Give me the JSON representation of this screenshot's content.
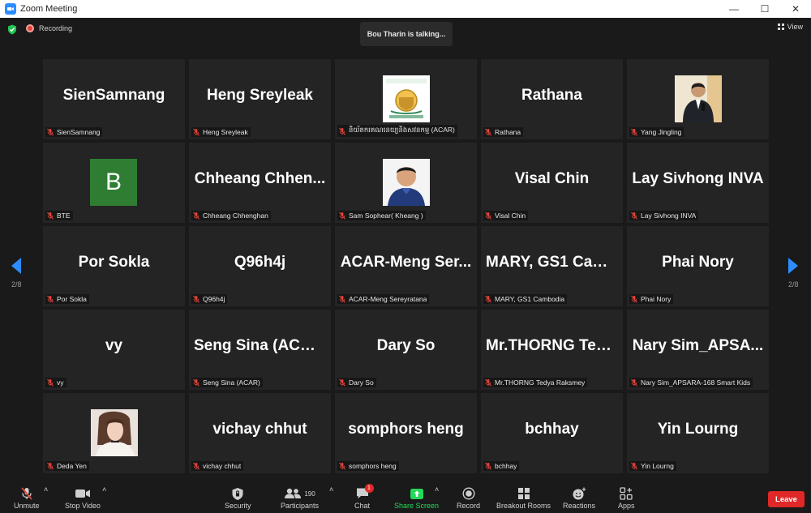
{
  "window": {
    "title": "Zoom Meeting",
    "controls": [
      "—",
      "☐",
      "✕"
    ]
  },
  "header": {
    "recording_label": "Recording",
    "talking_banner": "Bou Tharin is talking...",
    "view_label": "View"
  },
  "pagination": {
    "left_page": "2/8",
    "right_page": "2/8"
  },
  "participants": [
    {
      "big": "SienSamnang",
      "label": "SienSamnang",
      "kind": "name"
    },
    {
      "big": "Heng Sreyleak",
      "label": "Heng Sreyleak",
      "kind": "name"
    },
    {
      "big": "",
      "label": "និយ័តករគណនេយ្យនិងសវនកម្ម (ACAR)",
      "kind": "logo"
    },
    {
      "big": "Rathana",
      "label": "Rathana",
      "kind": "name"
    },
    {
      "big": "",
      "label": "Yang Jingling",
      "kind": "photo-man-suit"
    },
    {
      "big": "B",
      "label": "BTE",
      "kind": "avatar-letter",
      "avatar_color": "#2e7d32"
    },
    {
      "big": "Chheang  Chhen...",
      "label": "Chheang Chhenghan",
      "kind": "name"
    },
    {
      "big": "",
      "label": "Sam Sophear( Kheang )",
      "kind": "photo-man-blue"
    },
    {
      "big": "Visal Chin",
      "label": "Visal Chin",
      "kind": "name"
    },
    {
      "big": "Lay Sivhong INVA",
      "label": "Lay Sivhong INVA",
      "kind": "name"
    },
    {
      "big": "Por Sokla",
      "label": "Por Sokla",
      "kind": "name"
    },
    {
      "big": "Q96h4j",
      "label": "Q96h4j",
      "kind": "name"
    },
    {
      "big": "ACAR-Meng  Ser...",
      "label": "ACAR-Meng Sereyratana",
      "kind": "name"
    },
    {
      "big": "MARY,  GS1  Cam...",
      "label": "MARY, GS1 Cambodia",
      "kind": "name"
    },
    {
      "big": "Phai Nory",
      "label": "Phai Nory",
      "kind": "name"
    },
    {
      "big": "vy",
      "label": "vy",
      "kind": "name"
    },
    {
      "big": "Seng Sina (ACAR)",
      "label": "Seng Sina (ACAR)",
      "kind": "name"
    },
    {
      "big": "Dary So",
      "label": "Dary So",
      "kind": "name"
    },
    {
      "big": "Mr.THORNG  Ted...",
      "label": "Mr.THORNG Tedya Raksmey",
      "kind": "name"
    },
    {
      "big": "Nary  Sim_APSA...",
      "label": "Nary Sim_APSARA-168 Smart Kids",
      "kind": "name"
    },
    {
      "big": "",
      "label": "Deda Yen",
      "kind": "photo-woman"
    },
    {
      "big": "vichay chhut",
      "label": "vichay chhut",
      "kind": "name"
    },
    {
      "big": "somphors heng",
      "label": "somphors heng",
      "kind": "name"
    },
    {
      "big": "bchhay",
      "label": "bchhay",
      "kind": "name"
    },
    {
      "big": "Yin Lourng",
      "label": "Yin Lourng",
      "kind": "name"
    }
  ],
  "toolbar": {
    "unmute": "Unmute",
    "stop_video": "Stop Video",
    "security": "Security",
    "participants": "Participants",
    "participants_count": "190",
    "chat": "Chat",
    "chat_badge": "1",
    "share_screen": "Share Screen",
    "record": "Record",
    "breakout_rooms": "Breakout Rooms",
    "reactions": "Reactions",
    "apps": "Apps",
    "leave": "Leave"
  },
  "colors": {
    "accent": "#2d8cff",
    "share_green": "#23d959",
    "leave_red": "#e02828",
    "muted_red": "#e0443a"
  }
}
